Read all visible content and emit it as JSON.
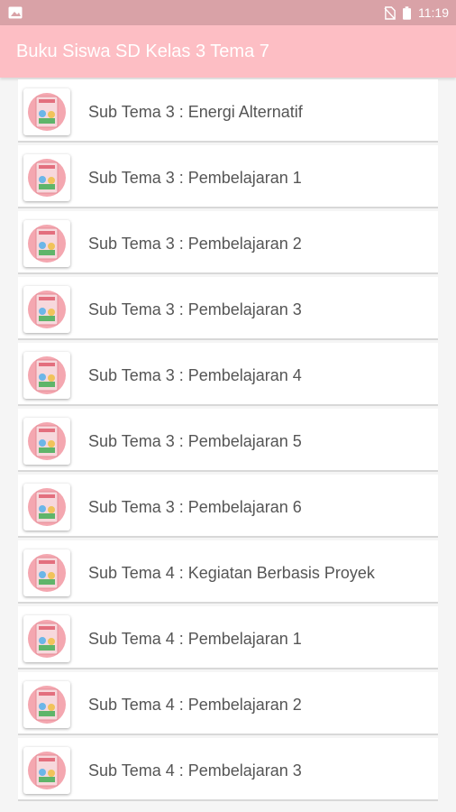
{
  "status_bar": {
    "time": "11:19",
    "icons": [
      "image-icon",
      "no-sim-icon",
      "battery-icon"
    ]
  },
  "app_bar": {
    "title": "Buku Siswa SD Kelas 3 Tema 7",
    "background": "#fdbec4"
  },
  "list": {
    "items": [
      {
        "label": "Sub Tema 3 : Energi Alternatif",
        "icon": "book-cover-icon"
      },
      {
        "label": "Sub Tema 3 : Pembelajaran 1",
        "icon": "book-cover-icon"
      },
      {
        "label": "Sub Tema 3 : Pembelajaran 2",
        "icon": "book-cover-icon"
      },
      {
        "label": "Sub Tema 3 : Pembelajaran 3",
        "icon": "book-cover-icon"
      },
      {
        "label": "Sub Tema 3 : Pembelajaran 4",
        "icon": "book-cover-icon"
      },
      {
        "label": "Sub Tema 3 : Pembelajaran 5",
        "icon": "book-cover-icon"
      },
      {
        "label": "Sub Tema 3 : Pembelajaran 6",
        "icon": "book-cover-icon"
      },
      {
        "label": "Sub Tema 4 : Kegiatan Berbasis Proyek",
        "icon": "book-cover-icon"
      },
      {
        "label": "Sub Tema 4 : Pembelajaran 1",
        "icon": "book-cover-icon"
      },
      {
        "label": "Sub Tema 4 : Pembelajaran 2",
        "icon": "book-cover-icon"
      },
      {
        "label": "Sub Tema 4 : Pembelajaran 3",
        "icon": "book-cover-icon"
      }
    ]
  }
}
